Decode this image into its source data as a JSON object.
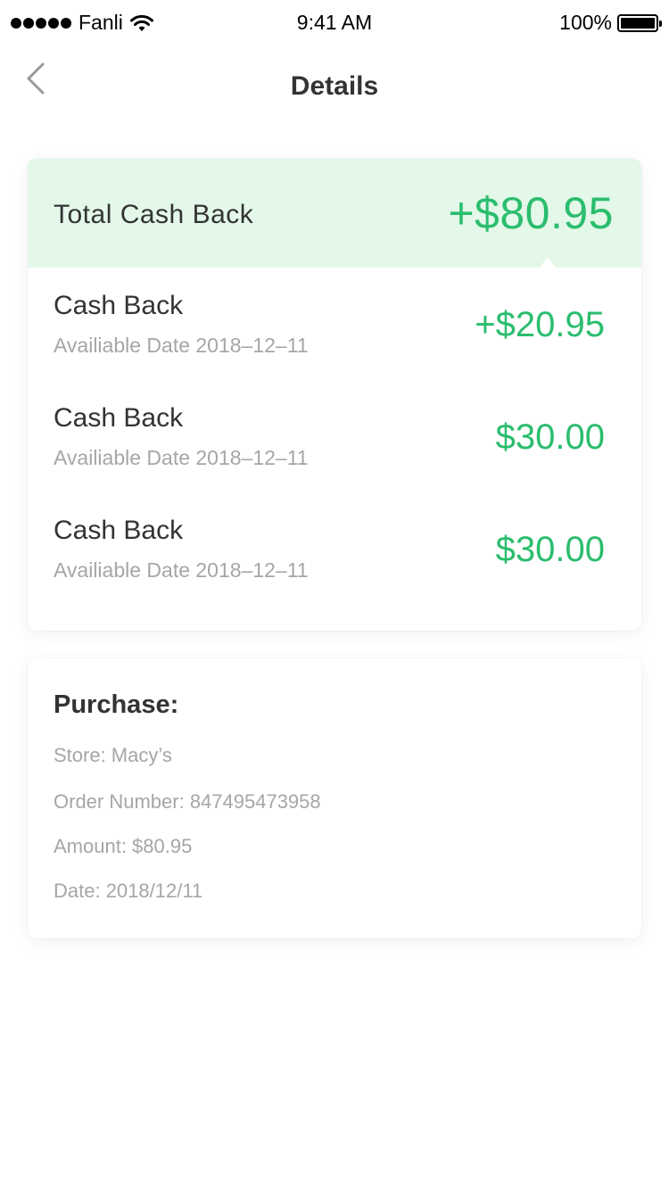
{
  "status_bar": {
    "carrier": "Fanli",
    "time": "9:41 AM",
    "battery": "100%",
    "battery_level": 1.0
  },
  "nav": {
    "title": "Details",
    "back_icon": "chevron-left-icon"
  },
  "cash_back": {
    "total_label": "Total Cash Back",
    "total_amount": "+$80.95",
    "items": [
      {
        "title": "Cash Back",
        "date": "Availiable Date 2018–12–11",
        "amount": "+$20.95"
      },
      {
        "title": "Cash Back",
        "date": "Availiable Date 2018–12–11",
        "amount": "$30.00"
      },
      {
        "title": "Cash Back",
        "date": "Availiable Date 2018–12–11",
        "amount": "$30.00"
      }
    ]
  },
  "purchase": {
    "title": "Purchase:",
    "store": "Store: Macy’s",
    "order_number": "Order Number: 847495473958",
    "amount": "Amount: $80.95",
    "date": "Date: 2018/12/11"
  },
  "colors": {
    "accent_green": "#2bbd6e",
    "header_bg": "#e3f8e9"
  }
}
